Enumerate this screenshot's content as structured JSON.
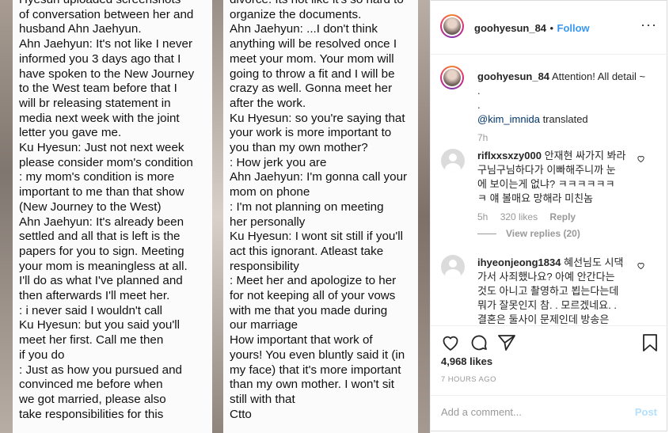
{
  "post_image": {
    "left_page_lines": [
      "Hyesun uploaded screenshots",
      "of conversation between her and",
      "husband Ahn Jaehyun.",
      "Ahn Jaehyun: It's not like I never",
      "informed you 3 days ago that I",
      "have spoken to the New Journey",
      "to the West team before that I",
      "will br releasing statement in",
      "media next week with the joint",
      "letter you gave me.",
      "Ku Hyesun: Just not next week",
      "please consider mom's condition",
      ": my mom's condition is more",
      "important to me than that show",
      "(New Journey to the West)",
      "Ahn Jaehyun: It's already been",
      "settled and all that is left is the",
      "papers for you to sign. Meeting",
      "your mom is meaningless at all.",
      "I'll do as what I've planned and",
      "then afterwards I'll meet her.",
      ": i never said I wouldn't call",
      "Ku Hyesun: but you said you'll",
      "meet her first. Call me then",
      "if you do",
      ": Just as how you pursued and",
      "convinced me before when",
      "we got married, please also",
      "take responsibilities for this"
    ],
    "right_page_lines": [
      "divorce. Its not like it's so hard to",
      "organize the documents.",
      "Ahn Jaehyun: ...I don't think",
      "anything will be resolved once I",
      "meet your mom. Your mom will",
      "going to throw a fit and I will be",
      "crazy as well. Gonna meet her",
      "after the work.",
      "Ku Hyesun: so you're saying that",
      "your work is more important to",
      "you than my own mother?",
      ": How jerk you are",
      "Ahn Jaehyun: I'm gonna call your",
      "mom on phone",
      ": I'm not planning on meeting",
      "her personally",
      "Ku Hyesun: I wont sit still if you'll",
      "act this ignorant. Atleast take",
      "responsibility",
      ": Meet her and apologize to her",
      "for not keeping all of your vows",
      "with me that you made during",
      "our marriage",
      "How important that work of",
      "yours! You even bluntly said it (in",
      "my face) that it's more important",
      "than my own mother. I won't sit",
      "still with that",
      "Ctto"
    ]
  },
  "header": {
    "username": "goohyesun_84",
    "separator": "•",
    "follow_label": "Follow",
    "more_icon": "ellipsis-icon"
  },
  "caption": {
    "username": "goohyesun_84",
    "text": "Attention! All detail ~",
    "dot1": ".",
    "dot2": ".",
    "mention": "@kim_imnida",
    "translated": " translated",
    "time": "7h"
  },
  "comments": [
    {
      "username": "riflxxsxzy000",
      "text": "안재현 싸가지 봐라 구님구님하다가 이빠해주니까 눈에 보이는게 없냐? ㅋㅋㅋㅋㅋㅋㅋ 얘 볼매요 망해라 미친놈",
      "line1": "안재현 싸가지 봐라",
      "line2": "구님구님하다가 이빠해주니까 눈",
      "line3": "에 보이는게 없냐? ㅋㅋㅋㅋㅋㅋ",
      "line4": "ㅋ 얘 볼매요 망해라 미친놈",
      "time": "5h",
      "likes": "320 likes",
      "reply": "Reply",
      "view_replies": "View replies (20)"
    },
    {
      "username": "ihyeonjeong1834",
      "line1": "혜선님도 시댁",
      "line2": "가서 사죄했나요? 아예 안간다는",
      "line3": "것도 아니고 촬영하고 뵙는다는데",
      "line4": "뭐가 잘못인지 참. . 모르겠네요. .",
      "line5": "결혼은 둘사이 문제인데 방송은"
    }
  ],
  "actions": {
    "like_icon": "heart-icon",
    "comment_icon": "comment-bubble-icon",
    "share_icon": "share-icon",
    "save_icon": "bookmark-icon",
    "likes": "4,968 likes",
    "timestamp": "7 HOURS AGO"
  },
  "add_comment": {
    "placeholder": "Add a comment...",
    "post_label": "Post"
  }
}
